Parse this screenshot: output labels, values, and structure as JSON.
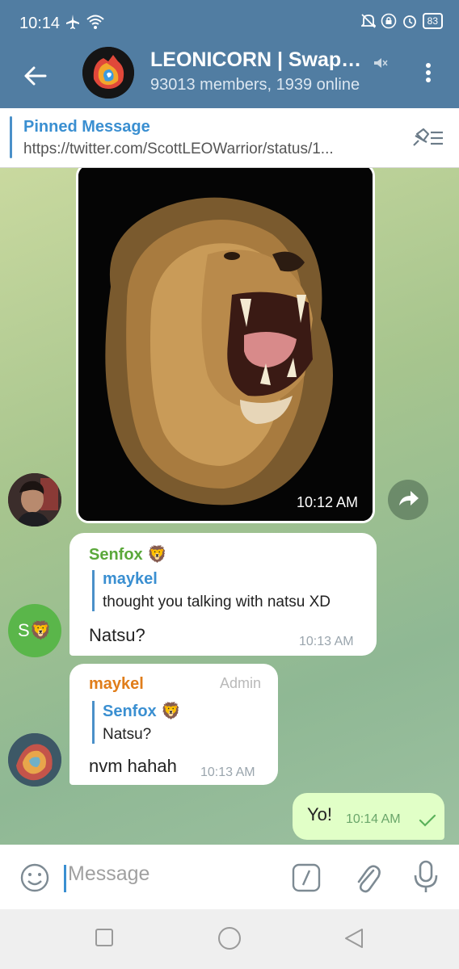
{
  "status_bar": {
    "time": "10:14",
    "battery": "83"
  },
  "header": {
    "title": "LEONICORN | Swap…",
    "subtitle": "93013 members, 1939 online"
  },
  "pinned": {
    "label": "Pinned Message",
    "text": "https://twitter.com/ScottLEOWarrior/status/1..."
  },
  "messages": {
    "photo_time": "10:12 AM",
    "m1": {
      "sender": "Senfox 🦁",
      "reply_name": "maykel",
      "reply_text": "thought you talking with natsu XD",
      "text": "Natsu?",
      "time": "10:13 AM",
      "avatar_text": "S🦁"
    },
    "m2": {
      "sender": "maykel",
      "admin": "Admin",
      "reply_name": "Senfox 🦁",
      "reply_text": "Natsu?",
      "text": "nvm hahah",
      "time": "10:13 AM"
    },
    "m3": {
      "text": "Yo!",
      "time": "10:14 AM"
    }
  },
  "input": {
    "placeholder": "Message"
  },
  "colors": {
    "header": "#517da2",
    "link": "#3a8fd1",
    "sender_green": "#5aa83a",
    "sender_orange": "#e07d1a",
    "outgoing_bubble": "#e1ffc7"
  }
}
